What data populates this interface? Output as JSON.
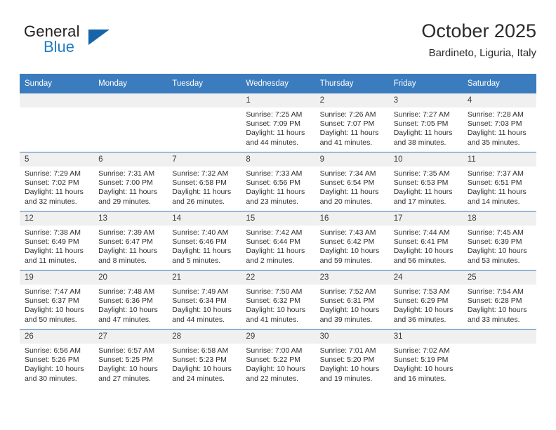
{
  "brand": {
    "name_top": "General",
    "name_bottom": "Blue",
    "triangle_color": "#1565a8",
    "blue_color": "#1f7cc4"
  },
  "header": {
    "title": "October 2025",
    "subtitle": "Bardineto, Liguria, Italy"
  },
  "theme": {
    "header_bg": "#3a7cbe",
    "header_text": "#ffffff",
    "daynum_bg": "#f0f0f0",
    "grid_line": "#3a7cbe"
  },
  "weekdays": [
    "Sunday",
    "Monday",
    "Tuesday",
    "Wednesday",
    "Thursday",
    "Friday",
    "Saturday"
  ],
  "labels": {
    "sunrise_prefix": "Sunrise:",
    "sunset_prefix": "Sunset:",
    "daylight_prefix": "Daylight:"
  },
  "weeks": [
    [
      {
        "day": "",
        "empty": true
      },
      {
        "day": "",
        "empty": true
      },
      {
        "day": "",
        "empty": true
      },
      {
        "day": "1",
        "sunrise": "Sunrise: 7:25 AM",
        "sunset": "Sunset: 7:09 PM",
        "daylight1": "Daylight: 11 hours",
        "daylight2": "and 44 minutes."
      },
      {
        "day": "2",
        "sunrise": "Sunrise: 7:26 AM",
        "sunset": "Sunset: 7:07 PM",
        "daylight1": "Daylight: 11 hours",
        "daylight2": "and 41 minutes."
      },
      {
        "day": "3",
        "sunrise": "Sunrise: 7:27 AM",
        "sunset": "Sunset: 7:05 PM",
        "daylight1": "Daylight: 11 hours",
        "daylight2": "and 38 minutes."
      },
      {
        "day": "4",
        "sunrise": "Sunrise: 7:28 AM",
        "sunset": "Sunset: 7:03 PM",
        "daylight1": "Daylight: 11 hours",
        "daylight2": "and 35 minutes."
      }
    ],
    [
      {
        "day": "5",
        "sunrise": "Sunrise: 7:29 AM",
        "sunset": "Sunset: 7:02 PM",
        "daylight1": "Daylight: 11 hours",
        "daylight2": "and 32 minutes."
      },
      {
        "day": "6",
        "sunrise": "Sunrise: 7:31 AM",
        "sunset": "Sunset: 7:00 PM",
        "daylight1": "Daylight: 11 hours",
        "daylight2": "and 29 minutes."
      },
      {
        "day": "7",
        "sunrise": "Sunrise: 7:32 AM",
        "sunset": "Sunset: 6:58 PM",
        "daylight1": "Daylight: 11 hours",
        "daylight2": "and 26 minutes."
      },
      {
        "day": "8",
        "sunrise": "Sunrise: 7:33 AM",
        "sunset": "Sunset: 6:56 PM",
        "daylight1": "Daylight: 11 hours",
        "daylight2": "and 23 minutes."
      },
      {
        "day": "9",
        "sunrise": "Sunrise: 7:34 AM",
        "sunset": "Sunset: 6:54 PM",
        "daylight1": "Daylight: 11 hours",
        "daylight2": "and 20 minutes."
      },
      {
        "day": "10",
        "sunrise": "Sunrise: 7:35 AM",
        "sunset": "Sunset: 6:53 PM",
        "daylight1": "Daylight: 11 hours",
        "daylight2": "and 17 minutes."
      },
      {
        "day": "11",
        "sunrise": "Sunrise: 7:37 AM",
        "sunset": "Sunset: 6:51 PM",
        "daylight1": "Daylight: 11 hours",
        "daylight2": "and 14 minutes."
      }
    ],
    [
      {
        "day": "12",
        "sunrise": "Sunrise: 7:38 AM",
        "sunset": "Sunset: 6:49 PM",
        "daylight1": "Daylight: 11 hours",
        "daylight2": "and 11 minutes."
      },
      {
        "day": "13",
        "sunrise": "Sunrise: 7:39 AM",
        "sunset": "Sunset: 6:47 PM",
        "daylight1": "Daylight: 11 hours",
        "daylight2": "and 8 minutes."
      },
      {
        "day": "14",
        "sunrise": "Sunrise: 7:40 AM",
        "sunset": "Sunset: 6:46 PM",
        "daylight1": "Daylight: 11 hours",
        "daylight2": "and 5 minutes."
      },
      {
        "day": "15",
        "sunrise": "Sunrise: 7:42 AM",
        "sunset": "Sunset: 6:44 PM",
        "daylight1": "Daylight: 11 hours",
        "daylight2": "and 2 minutes."
      },
      {
        "day": "16",
        "sunrise": "Sunrise: 7:43 AM",
        "sunset": "Sunset: 6:42 PM",
        "daylight1": "Daylight: 10 hours",
        "daylight2": "and 59 minutes."
      },
      {
        "day": "17",
        "sunrise": "Sunrise: 7:44 AM",
        "sunset": "Sunset: 6:41 PM",
        "daylight1": "Daylight: 10 hours",
        "daylight2": "and 56 minutes."
      },
      {
        "day": "18",
        "sunrise": "Sunrise: 7:45 AM",
        "sunset": "Sunset: 6:39 PM",
        "daylight1": "Daylight: 10 hours",
        "daylight2": "and 53 minutes."
      }
    ],
    [
      {
        "day": "19",
        "sunrise": "Sunrise: 7:47 AM",
        "sunset": "Sunset: 6:37 PM",
        "daylight1": "Daylight: 10 hours",
        "daylight2": "and 50 minutes."
      },
      {
        "day": "20",
        "sunrise": "Sunrise: 7:48 AM",
        "sunset": "Sunset: 6:36 PM",
        "daylight1": "Daylight: 10 hours",
        "daylight2": "and 47 minutes."
      },
      {
        "day": "21",
        "sunrise": "Sunrise: 7:49 AM",
        "sunset": "Sunset: 6:34 PM",
        "daylight1": "Daylight: 10 hours",
        "daylight2": "and 44 minutes."
      },
      {
        "day": "22",
        "sunrise": "Sunrise: 7:50 AM",
        "sunset": "Sunset: 6:32 PM",
        "daylight1": "Daylight: 10 hours",
        "daylight2": "and 41 minutes."
      },
      {
        "day": "23",
        "sunrise": "Sunrise: 7:52 AM",
        "sunset": "Sunset: 6:31 PM",
        "daylight1": "Daylight: 10 hours",
        "daylight2": "and 39 minutes."
      },
      {
        "day": "24",
        "sunrise": "Sunrise: 7:53 AM",
        "sunset": "Sunset: 6:29 PM",
        "daylight1": "Daylight: 10 hours",
        "daylight2": "and 36 minutes."
      },
      {
        "day": "25",
        "sunrise": "Sunrise: 7:54 AM",
        "sunset": "Sunset: 6:28 PM",
        "daylight1": "Daylight: 10 hours",
        "daylight2": "and 33 minutes."
      }
    ],
    [
      {
        "day": "26",
        "sunrise": "Sunrise: 6:56 AM",
        "sunset": "Sunset: 5:26 PM",
        "daylight1": "Daylight: 10 hours",
        "daylight2": "and 30 minutes."
      },
      {
        "day": "27",
        "sunrise": "Sunrise: 6:57 AM",
        "sunset": "Sunset: 5:25 PM",
        "daylight1": "Daylight: 10 hours",
        "daylight2": "and 27 minutes."
      },
      {
        "day": "28",
        "sunrise": "Sunrise: 6:58 AM",
        "sunset": "Sunset: 5:23 PM",
        "daylight1": "Daylight: 10 hours",
        "daylight2": "and 24 minutes."
      },
      {
        "day": "29",
        "sunrise": "Sunrise: 7:00 AM",
        "sunset": "Sunset: 5:22 PM",
        "daylight1": "Daylight: 10 hours",
        "daylight2": "and 22 minutes."
      },
      {
        "day": "30",
        "sunrise": "Sunrise: 7:01 AM",
        "sunset": "Sunset: 5:20 PM",
        "daylight1": "Daylight: 10 hours",
        "daylight2": "and 19 minutes."
      },
      {
        "day": "31",
        "sunrise": "Sunrise: 7:02 AM",
        "sunset": "Sunset: 5:19 PM",
        "daylight1": "Daylight: 10 hours",
        "daylight2": "and 16 minutes."
      },
      {
        "day": "",
        "empty": true
      }
    ]
  ]
}
